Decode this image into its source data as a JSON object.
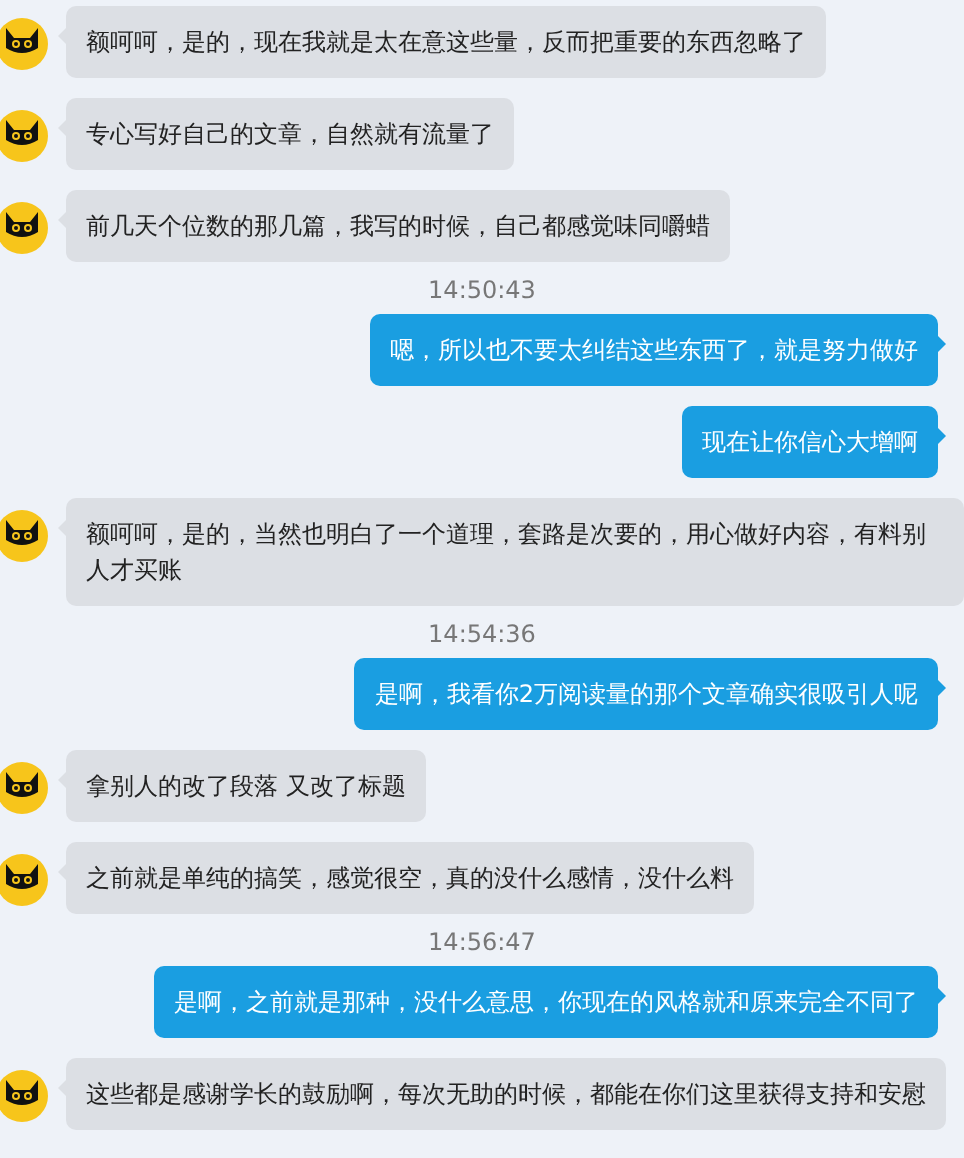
{
  "messages": [
    {
      "kind": "incoming",
      "text": "额呵呵，是的，现在我就是太在意这些量，反而把重要的东西忽略了"
    },
    {
      "kind": "incoming",
      "text": "专心写好自己的文章，自然就有流量了"
    },
    {
      "kind": "incoming",
      "text": "前几天个位数的那几篇，我写的时候，自己都感觉味同嚼蜡"
    },
    {
      "kind": "time",
      "text": "14:50:43"
    },
    {
      "kind": "outgoing",
      "text": "嗯，所以也不要太纠结这些东西了，就是努力做好"
    },
    {
      "kind": "outgoing",
      "text": "现在让你信心大增啊"
    },
    {
      "kind": "incoming",
      "text": "额呵呵，是的，当然也明白了一个道理，套路是次要的，用心做好内容，有料别人才买账"
    },
    {
      "kind": "time",
      "text": "14:54:36"
    },
    {
      "kind": "outgoing",
      "text": "是啊，我看你2万阅读量的那个文章确实很吸引人呢"
    },
    {
      "kind": "incoming",
      "text": "拿别人的改了段落  又改了标题"
    },
    {
      "kind": "incoming",
      "text": "之前就是单纯的搞笑，感觉很空，真的没什么感情，没什么料"
    },
    {
      "kind": "time",
      "text": "14:56:47"
    },
    {
      "kind": "outgoing",
      "text": "是啊，之前就是那种，没什么意思，你现在的风格就和原来完全不同了"
    },
    {
      "kind": "incoming",
      "text": "这些都是感谢学长的鼓励啊，每次无助的时候，都能在你们这里获得支持和安慰"
    }
  ]
}
